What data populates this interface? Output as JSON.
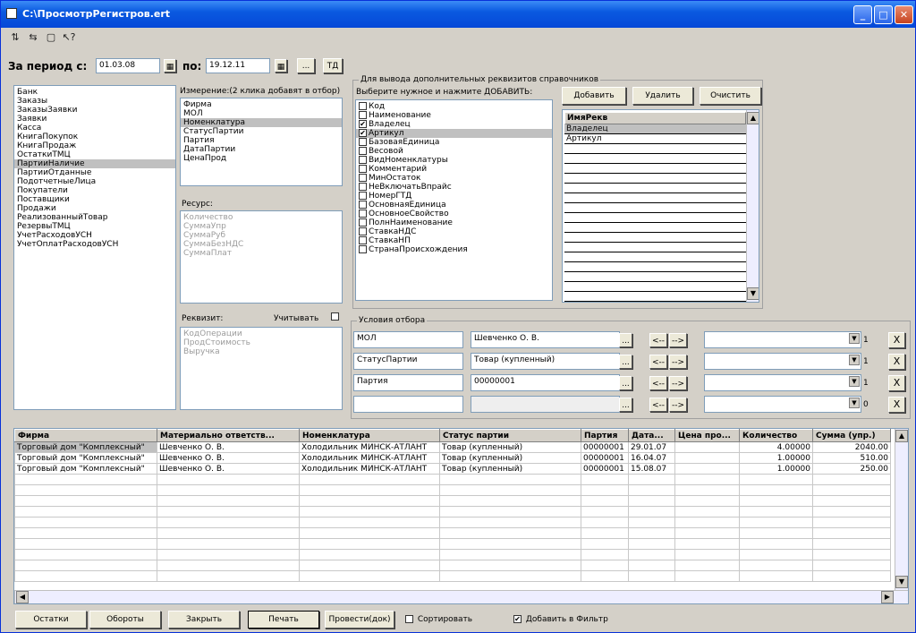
{
  "window": {
    "title": "C:\\ПросмотрРегистров.ert",
    "min": "_",
    "max": "□",
    "close": "✕"
  },
  "toolbar": {
    "icons": [
      "open-icon",
      "save-icon",
      "help-icon",
      "pointer-help-icon"
    ]
  },
  "period": {
    "from_label": "За период с:",
    "from_value": "01.03.08",
    "to_label": "по:",
    "to_value": "19.12.11",
    "more": "...",
    "td": "ТД"
  },
  "registers": [
    "Банк",
    "Заказы",
    "ЗаказыЗаявки",
    "Заявки",
    "Касса",
    "КнигаПокупок",
    "КнигаПродаж",
    "ОстаткиТМЦ",
    "ПартииНаличие",
    "ПартииОтданные",
    "ПодотчетныеЛица",
    "Покупатели",
    "Поставщики",
    "Продажи",
    "РеализованныйТовар",
    "РезервыТМЦ",
    "УчетРасходовУСН",
    "УчетОплатРасходовУСН"
  ],
  "registers_selected": 8,
  "dimension": {
    "label": "Измерение:(2 клика добавят в отбор)",
    "items": [
      "Фирма",
      "МОЛ",
      "Номенклатура",
      "СтатусПартии",
      "Партия",
      "ДатаПартии",
      "ЦенаПрод"
    ],
    "selected": 2
  },
  "resource": {
    "label": "Ресурс:",
    "items": [
      "Количество",
      "СуммаУпр",
      "СуммаРуб",
      "СуммаБезНДС",
      "СуммаПлат"
    ]
  },
  "requisite": {
    "label": "Реквизит:",
    "consider_label": "Учитывать",
    "items": [
      "КодОперации",
      "ПродСтоимость",
      "Выручка"
    ]
  },
  "extra": {
    "group_title": "Для вывода дополнительных реквизитов справочников",
    "hint": "Выберите нужное и нажмите ДОБАВИТЬ:",
    "add": "Добавить",
    "delete": "Удалить",
    "clear": "Очистить",
    "items": [
      {
        "t": "Код",
        "c": false
      },
      {
        "t": "Наименование",
        "c": false
      },
      {
        "t": "Владелец",
        "c": true
      },
      {
        "t": "Артикул",
        "c": true
      },
      {
        "t": "БазоваяЕдиница",
        "c": false
      },
      {
        "t": "Весовой",
        "c": false
      },
      {
        "t": "ВидНоменклатуры",
        "c": false
      },
      {
        "t": "Комментарий",
        "c": false
      },
      {
        "t": "МинОстаток",
        "c": false
      },
      {
        "t": "НеВключатьВпрайс",
        "c": false
      },
      {
        "t": "НомерГТД",
        "c": false
      },
      {
        "t": "ОсновнаяЕдиница",
        "c": false
      },
      {
        "t": "ОсновноеСвойство",
        "c": false
      },
      {
        "t": "ПолнНаименование",
        "c": false
      },
      {
        "t": "СтавкаНДС",
        "c": false
      },
      {
        "t": "СтавкаНП",
        "c": false
      },
      {
        "t": "СтранаПроисхождения",
        "c": false
      }
    ],
    "selected": 3,
    "req_header": "ИмяРекв",
    "req_items": [
      "Владелец",
      "Артикул"
    ]
  },
  "filter": {
    "group_title": "Условия отбора",
    "rows": [
      {
        "name": "МОЛ",
        "value": "Шевченко О. В.",
        "count": "1"
      },
      {
        "name": "СтатусПартии",
        "value": "Товар (купленный)",
        "count": "1"
      },
      {
        "name": "Партия",
        "value": "00000001",
        "count": "1"
      },
      {
        "name": "",
        "value": "",
        "count": "0"
      }
    ],
    "dots": "...",
    "left": "<--",
    "right": "-->",
    "x": "X"
  },
  "grid": {
    "columns": [
      "Фирма",
      "Материально ответств...",
      "Номенклатура",
      "Статус партии",
      "Партия",
      "Дата...",
      "Цена про...",
      "Количество",
      "Сумма (упр.)"
    ],
    "rows": [
      [
        "Торговый дом \"Комплексный\"",
        "Шевченко О. В.",
        "Холодильник МИНСК-АТЛАНТ",
        "Товар (купленный)",
        "00000001",
        "29.01.07",
        "",
        "4.00000",
        "2040.00"
      ],
      [
        "Торговый дом \"Комплексный\"",
        "Шевченко О. В.",
        "Холодильник МИНСК-АТЛАНТ",
        "Товар (купленный)",
        "00000001",
        "16.04.07",
        "",
        "1.00000",
        "510.00"
      ],
      [
        "Торговый дом \"Комплексный\"",
        "Шевченко О. В.",
        "Холодильник МИНСК-АТЛАНТ",
        "Товар (купленный)",
        "00000001",
        "15.08.07",
        "",
        "1.00000",
        "250.00"
      ]
    ]
  },
  "bottom": {
    "rests": "Остатки",
    "turnover": "Обороты",
    "close": "Закрыть",
    "print": "Печать",
    "post": "Провести(док)",
    "sort": "Сортировать",
    "add_filter": "Добавить в Фильтр"
  }
}
